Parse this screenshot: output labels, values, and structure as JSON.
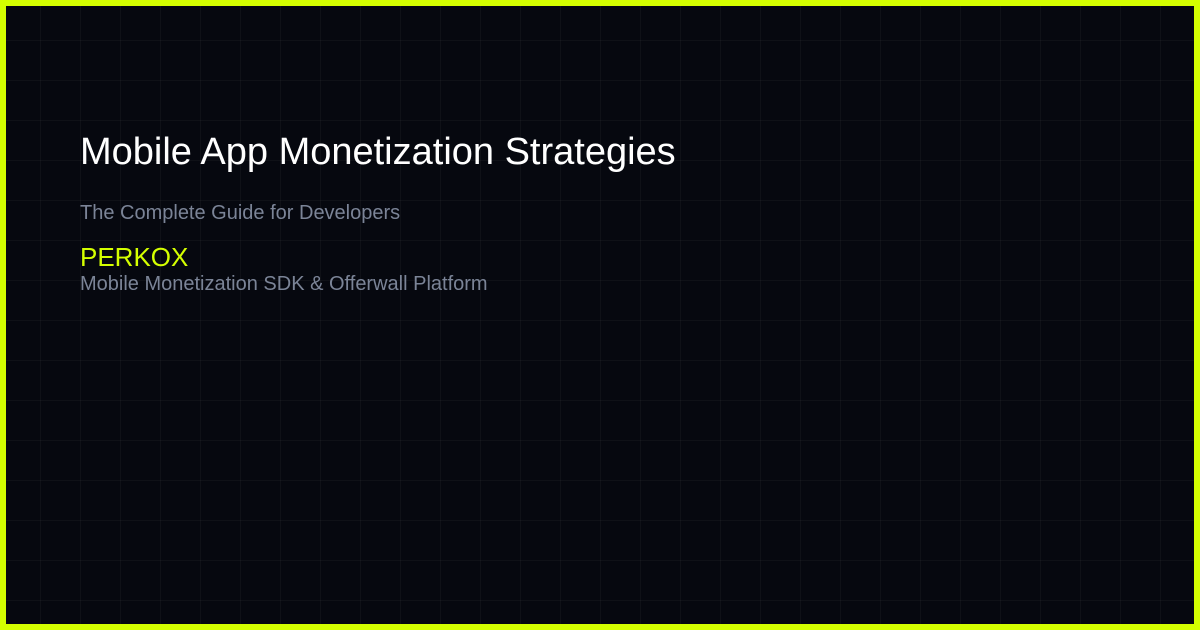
{
  "hero": {
    "title": "Mobile App Monetization Strategies",
    "subtitle": "The Complete Guide for Developers"
  },
  "brand": {
    "name": "PERKOX",
    "tagline": "Mobile Monetization SDK & Offerwall Platform"
  },
  "colors": {
    "accent": "#d4ff00",
    "background": "#06080f",
    "title_text": "#ffffff",
    "muted_text": "#7b8497"
  }
}
